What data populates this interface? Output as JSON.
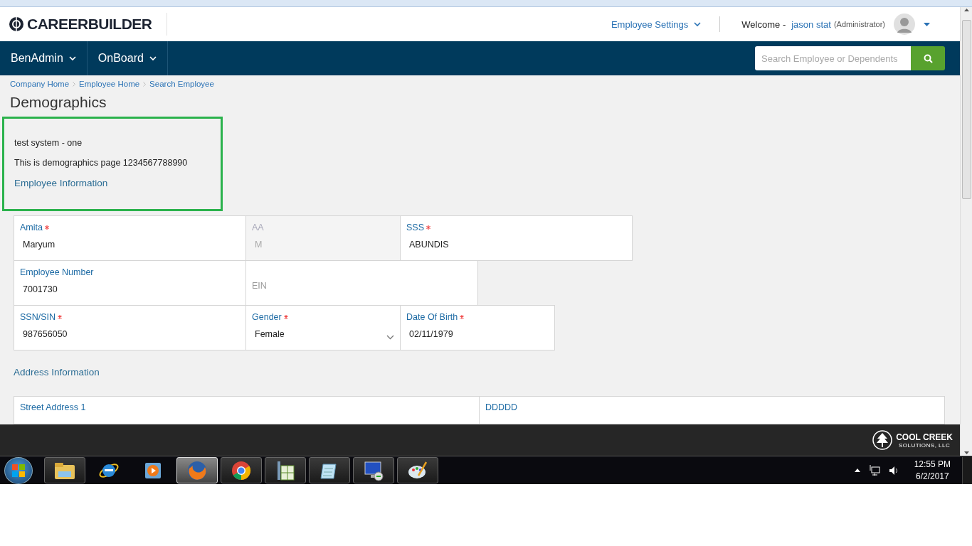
{
  "header": {
    "logo": "CAREERBUILDER",
    "settings_menu": "Employee Settings",
    "welcome": "Welcome -",
    "user_name": "jason stat",
    "user_role": "(Administrator)"
  },
  "nav": {
    "menus": [
      "BenAdmin",
      "OnBoard"
    ],
    "search": {
      "placeholder": "Search Employee or Dependents"
    }
  },
  "breadcrumbs": [
    "Company Home",
    "Employee Home",
    "Search Employee"
  ],
  "page_title": "Demographics",
  "info_box": {
    "lines": [
      "test system - one",
      "This is demographics page 1234567788990"
    ],
    "section": "Employee Information"
  },
  "field_rows": [
    [
      {
        "kind": "text",
        "label": "Amita",
        "value": "Maryum",
        "required": true,
        "disabled": false
      },
      {
        "kind": "text",
        "label": "AA",
        "value": "M",
        "required": false,
        "disabled": true
      },
      {
        "kind": "text",
        "label": "SSS",
        "value": "ABUNDIS",
        "required": true,
        "disabled": false
      }
    ],
    [
      {
        "kind": "text",
        "label": "Employee Number",
        "value": "7001730",
        "required": false,
        "disabled": false
      },
      {
        "kind": "empty",
        "label": "EIN"
      }
    ],
    [
      {
        "kind": "text",
        "label": "SSN/SIN",
        "value": "987656050",
        "required": true,
        "disabled": false
      },
      {
        "kind": "select",
        "label": "Gender",
        "value": "Female",
        "required": true,
        "disabled": false
      },
      {
        "kind": "text",
        "label": "Date Of Birth",
        "value": "02/11/1979",
        "required": true,
        "disabled": false
      }
    ]
  ],
  "address_section": "Address Information",
  "address_fields": [
    "Street Address 1",
    "DDDDD"
  ],
  "footer": {
    "brand": "COOL CREEK",
    "brand_sub": "SOLUTIONS, LLC"
  },
  "taskbar": {
    "apps": [
      {
        "kind": "folder",
        "selected": false
      },
      {
        "kind": "ie",
        "selected": false
      },
      {
        "kind": "media",
        "selected": false
      },
      {
        "kind": "firefox",
        "selected": true
      },
      {
        "kind": "chrome",
        "selected": false
      },
      {
        "kind": "spreadsheet",
        "selected": false
      },
      {
        "kind": "notepad",
        "selected": false
      },
      {
        "kind": "remote",
        "selected": false
      },
      {
        "kind": "paint",
        "selected": false
      }
    ],
    "time": "12:55 PM",
    "date": "6/2/2017"
  }
}
